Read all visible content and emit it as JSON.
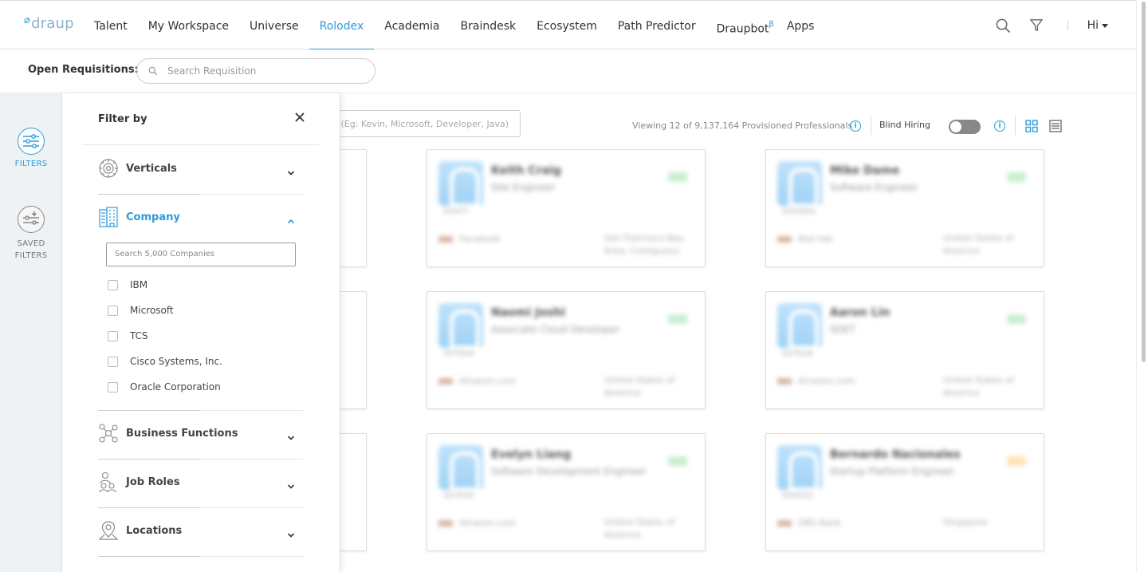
{
  "app": {
    "logo_text": "draup",
    "accent": "#2d9cdb"
  },
  "nav": {
    "items": [
      {
        "label": "Talent",
        "active": false
      },
      {
        "label": "My Workspace",
        "active": false
      },
      {
        "label": "Universe",
        "active": false
      },
      {
        "label": "Rolodex",
        "active": true
      },
      {
        "label": "Academia",
        "active": false
      },
      {
        "label": "Braindesk",
        "active": false
      },
      {
        "label": "Ecosystem",
        "active": false
      },
      {
        "label": "Path Predictor",
        "active": false
      },
      {
        "label": "Draupbot",
        "sup": "β",
        "active": false
      },
      {
        "label": "Apps",
        "active": false
      }
    ],
    "greeting": "Hi",
    "icons": [
      "search-icon",
      "filter-icon"
    ]
  },
  "requisition": {
    "label": "Open Requisitions:",
    "placeholder": "Search Requisition"
  },
  "rail": {
    "filters_label": "FILTERS",
    "saved_line1": "SAVED",
    "saved_line2": "FILTERS"
  },
  "results": {
    "search_placeholder": "s (Eg: Kevin, Microsoft, Developer, Java)",
    "viewing_text": "Viewing 12 of 9,137,164 Provisioned Professionals",
    "blind_hiring_label": "Blind Hiring",
    "blind_hiring_on": false,
    "view_mode": "grid",
    "cards": [
      {
        "name": "Keith Craig",
        "role": "Site Engineer",
        "code": "ASKP7",
        "company": "Facebook",
        "location": "San Francisco Bay Area, Contiguous",
        "tag": "green"
      },
      {
        "name": "Mike Dame",
        "role": "Software Engineer",
        "code": "ASKM09",
        "company": "Red Hat",
        "location": "United States of America",
        "tag": "green"
      },
      {
        "name": "Naomi Joshi",
        "role": "Associate Cloud Developer",
        "code": "ASTK06",
        "company": "Amazon.com",
        "location": "United States of America",
        "tag": "green"
      },
      {
        "name": "Aaron Lin",
        "role": "SDET",
        "code": "ASTK08",
        "company": "Amazon.com",
        "location": "United States of America",
        "tag": "green"
      },
      {
        "name": "Evelyn Liang",
        "role": "Software Development Engineer",
        "code": "ASTK09",
        "company": "Amazon.com",
        "location": "United States of America",
        "tag": "green"
      },
      {
        "name": "Bernardo Nacionales",
        "role": "Startup Platform Engineer",
        "code": "ASKE02",
        "company": "DBS Bank",
        "location": "Singapore",
        "tag": "amber"
      }
    ]
  },
  "filter_panel": {
    "title": "Filter by",
    "sections": [
      {
        "label": "Verticals",
        "icon": "gear-icon",
        "open": false
      },
      {
        "label": "Company",
        "icon": "building-icon",
        "open": true
      },
      {
        "label": "Business Functions",
        "icon": "network-icon",
        "open": false
      },
      {
        "label": "Job Roles",
        "icon": "people-icon",
        "open": false
      },
      {
        "label": "Locations",
        "icon": "map-pin-icon",
        "open": false
      }
    ],
    "company_search_placeholder": "Search 5,000 Companies",
    "companies": [
      "IBM",
      "Microsoft",
      "TCS",
      "Cisco Systems, Inc.",
      "Oracle Corporation"
    ]
  }
}
